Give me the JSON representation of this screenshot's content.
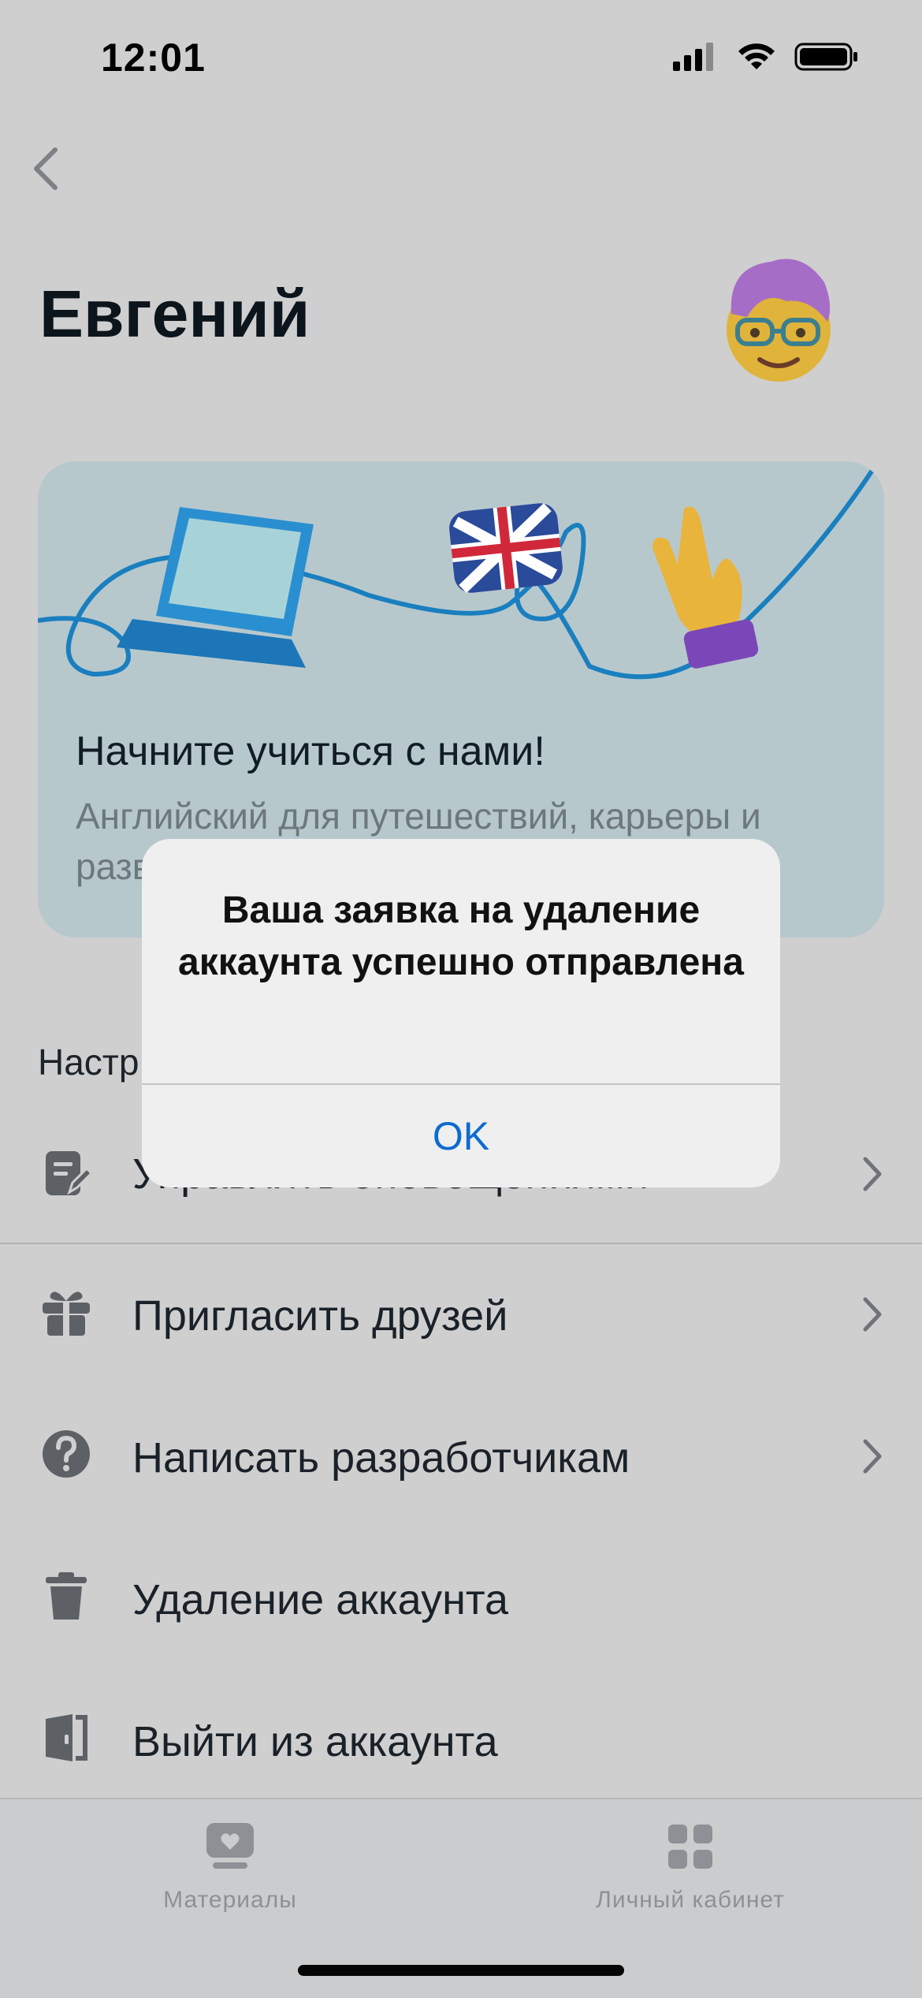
{
  "status_bar": {
    "time": "12:01"
  },
  "header": {
    "user_name": "Евгений"
  },
  "banner": {
    "title": "Начните учиться с нами!",
    "subtitle_line1": "Английский для путешествий, карьеры и",
    "subtitle_line2": "разв"
  },
  "section": {
    "label": "Настр"
  },
  "menu": {
    "items": [
      {
        "label": "Управлять оповещениями",
        "icon": "edit-note-icon",
        "chevron": true
      },
      {
        "label": "Пригласить друзей",
        "icon": "gift-icon",
        "chevron": true
      },
      {
        "label": "Написать разработчикам",
        "icon": "help-circle-icon",
        "chevron": true
      },
      {
        "label": "Удаление аккаунта",
        "icon": "trash-icon",
        "chevron": false
      },
      {
        "label": "Выйти из аккаунта",
        "icon": "logout-door-icon",
        "chevron": false
      }
    ]
  },
  "tabbar": {
    "tabs": [
      {
        "label": "Материалы",
        "icon": "materials-icon"
      },
      {
        "label": "Личный кабинет",
        "icon": "grid-icon"
      }
    ]
  },
  "alert": {
    "message": "Ваша заявка на удаление аккаунта успешно отправлена",
    "ok_label": "OK"
  },
  "colors": {
    "accent": "#0b6bd0",
    "overlay_bg": "#cfcfd0",
    "banner_bg": "#b7c8cd"
  }
}
